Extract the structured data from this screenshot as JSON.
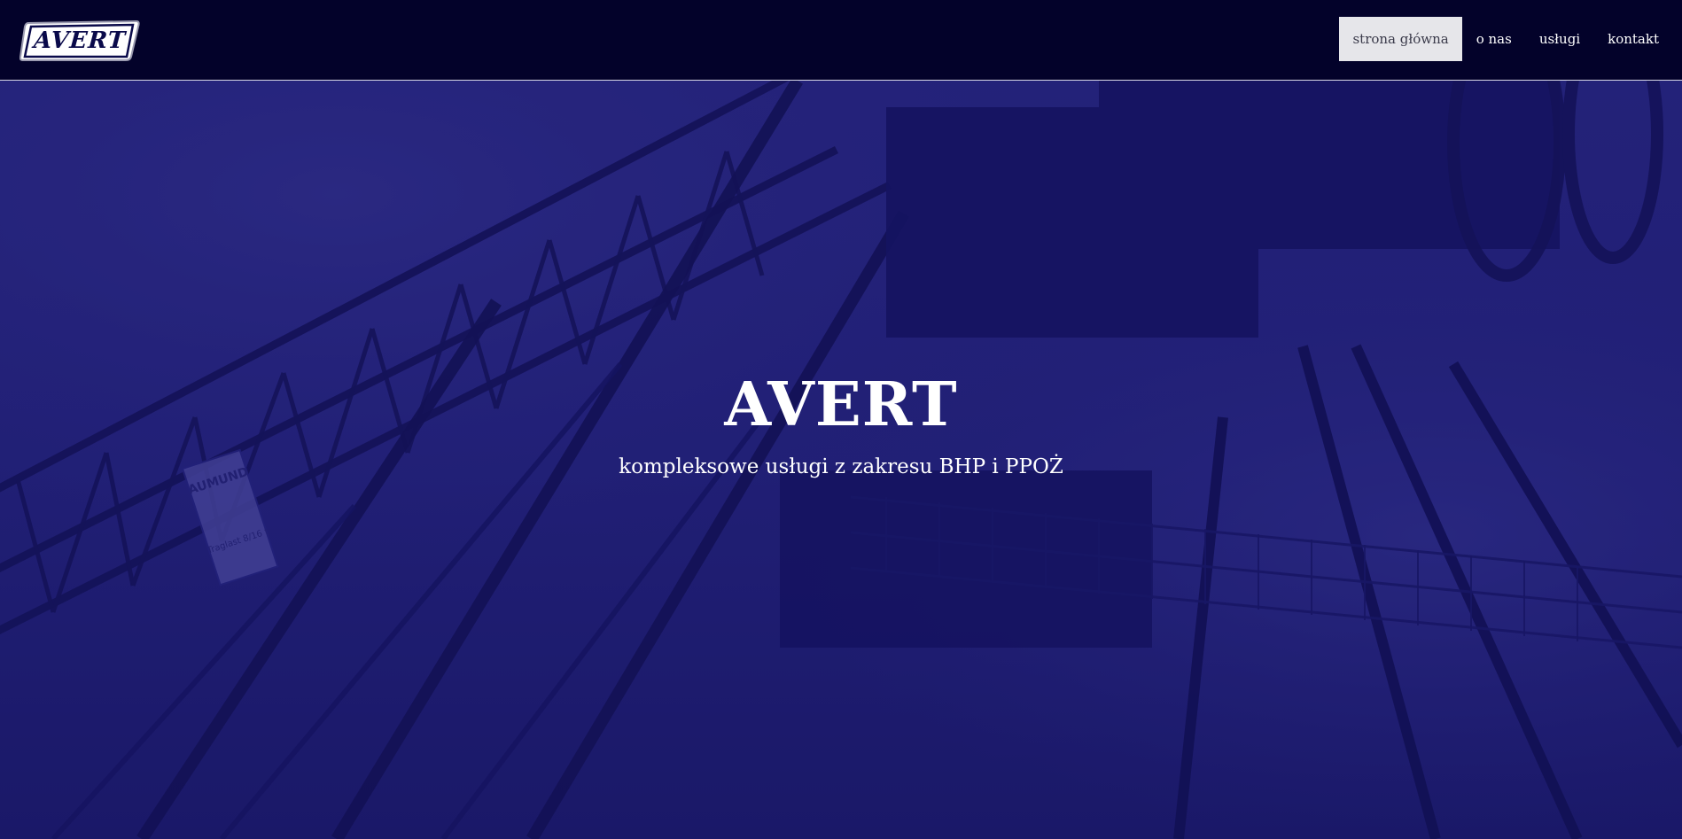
{
  "logo": {
    "text": "AVERT"
  },
  "nav": {
    "items": [
      {
        "label": "strona główna",
        "active": true
      },
      {
        "label": "o nas",
        "active": false
      },
      {
        "label": "usługi",
        "active": false
      },
      {
        "label": "kontakt",
        "active": false
      }
    ]
  },
  "hero": {
    "title": "AVERT",
    "subtitle": "kompleksowe usługi z zakresu BHP i PPOŻ",
    "sign_text": [
      "AUMUND",
      "Traglast 8/16 t"
    ]
  },
  "colors": {
    "header_bg": "#03022a",
    "hero_tint": "#23226e",
    "active_nav_bg": "#e6e6ea",
    "text_light": "#ffffff"
  }
}
